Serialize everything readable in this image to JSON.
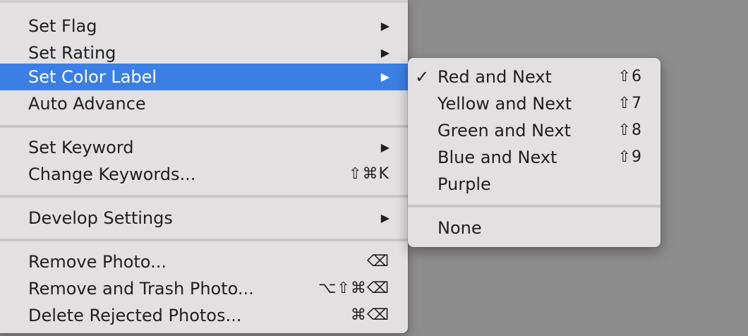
{
  "main_menu": {
    "items": [
      {
        "label": "Set Flag",
        "arrow": "▶"
      },
      {
        "label": "Set Rating",
        "arrow": "▶"
      },
      {
        "label": "Set Color Label",
        "arrow": "▶",
        "highlighted": true
      },
      {
        "label": "Auto Advance"
      },
      {
        "label": "Set Keyword",
        "arrow": "▶"
      },
      {
        "label": "Change Keywords...",
        "shortcut": "⇧⌘K"
      },
      {
        "label": "Develop Settings",
        "arrow": "▶"
      },
      {
        "label": "Remove Photo...",
        "shortcut": "⌫"
      },
      {
        "label": "Remove and Trash Photo...",
        "shortcut": "⌥⇧⌘⌫"
      },
      {
        "label": "Delete Rejected Photos...",
        "shortcut": "⌘⌫"
      }
    ]
  },
  "sub_menu": {
    "check_mark": "✓",
    "items": [
      {
        "label": "Red and Next",
        "shortcut": "⇧6",
        "checked": true
      },
      {
        "label": "Yellow and Next",
        "shortcut": "⇧7"
      },
      {
        "label": "Green and Next",
        "shortcut": "⇧8"
      },
      {
        "label": "Blue and Next",
        "shortcut": "⇧9"
      },
      {
        "label": "Purple"
      },
      {
        "label": "None"
      }
    ]
  },
  "colors": {
    "highlight": "#3b7fe4",
    "menu_background": "#e3e0e2",
    "desktop_background": "#8d8d8d"
  }
}
